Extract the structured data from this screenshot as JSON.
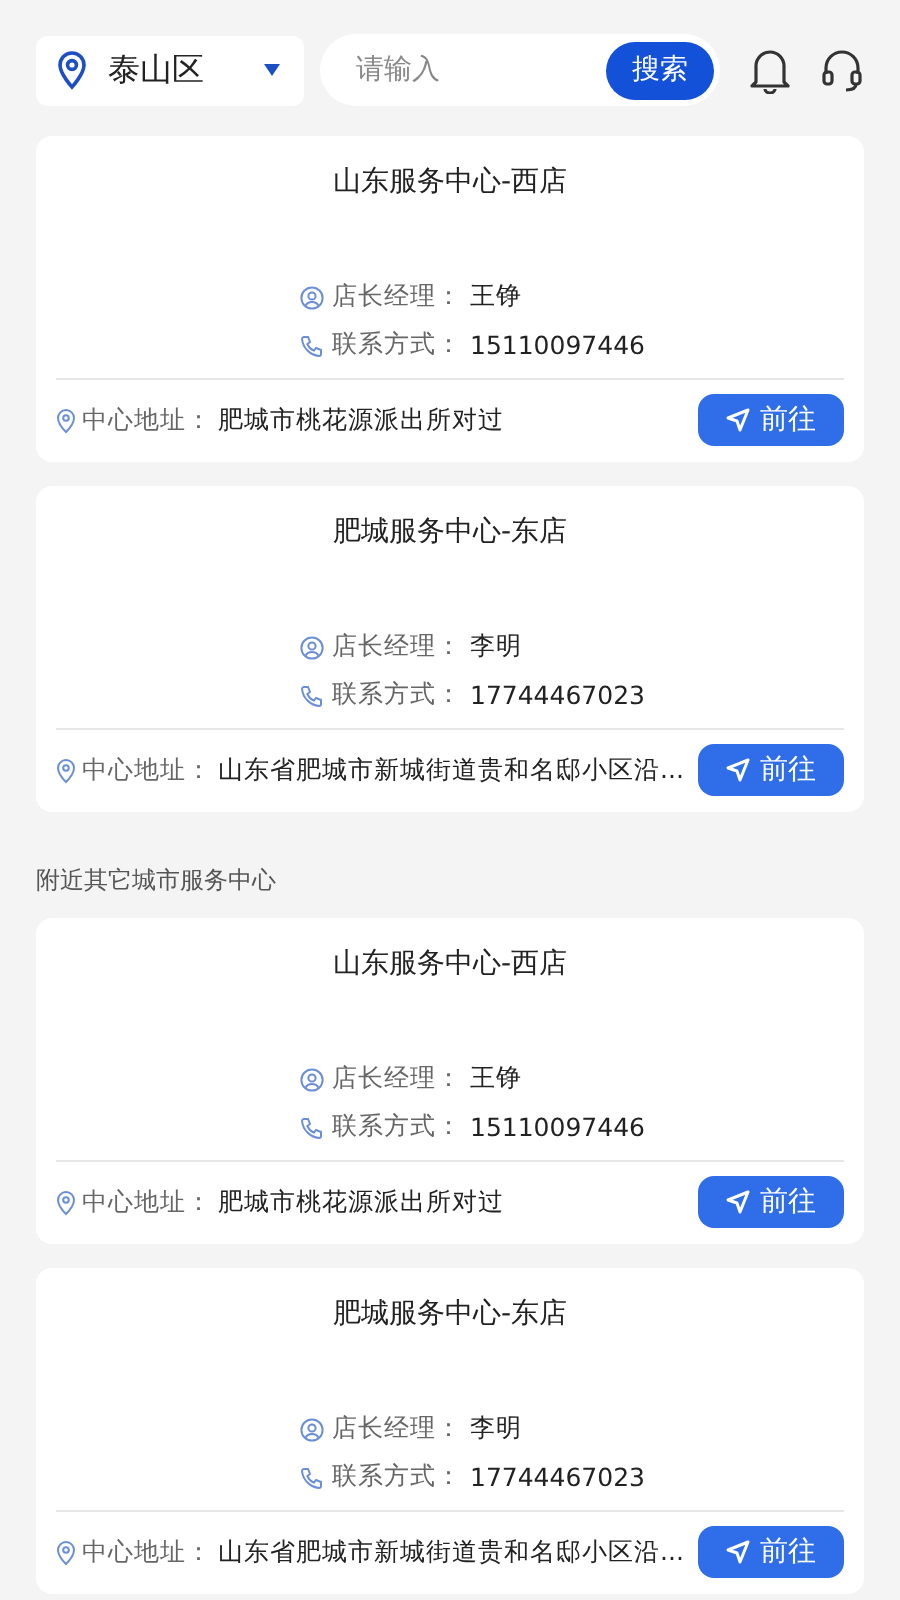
{
  "location": {
    "label": "泰山区"
  },
  "search": {
    "placeholder": "请输入",
    "button": "搜索"
  },
  "sections": [
    {
      "stores": [
        {
          "name": "山东服务中心-西店",
          "manager_label": "店长经理：",
          "manager": "王铮",
          "contact_label": "联系方式：",
          "contact": "15110097446",
          "address_label": "中心地址：",
          "address": "肥城市桃花源派出所对过",
          "go": "前往"
        },
        {
          "name": "肥城服务中心-东店",
          "manager_label": "店长经理：",
          "manager": "李明",
          "contact_label": "联系方式：",
          "contact": "17744467023",
          "address_label": "中心地址：",
          "address": "山东省肥城市新城街道贵和名邸小区沿...",
          "go": "前往"
        }
      ]
    },
    {
      "heading": "附近其它城市服务中心",
      "stores": [
        {
          "name": "山东服务中心-西店",
          "manager_label": "店长经理：",
          "manager": "王铮",
          "contact_label": "联系方式：",
          "contact": "15110097446",
          "address_label": "中心地址：",
          "address": "肥城市桃花源派出所对过",
          "go": "前往"
        },
        {
          "name": "肥城服务中心-东店",
          "manager_label": "店长经理：",
          "manager": "李明",
          "contact_label": "联系方式：",
          "contact": "17744467023",
          "address_label": "中心地址：",
          "address": "山东省肥城市新城街道贵和名邸小区沿...",
          "go": "前往"
        }
      ]
    }
  ]
}
